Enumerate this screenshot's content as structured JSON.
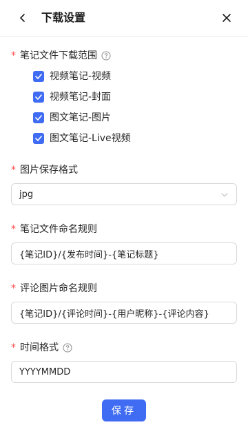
{
  "header": {
    "title": "下载设置",
    "back_icon": "chevron-left-icon",
    "close_icon": "close-icon"
  },
  "note_range": {
    "label": "笔记文件下载范围",
    "required_mark": "*",
    "help_icon": "question-circle-icon",
    "options": [
      {
        "label": "视频笔记-视频",
        "checked": true
      },
      {
        "label": "视频笔记-封面",
        "checked": true
      },
      {
        "label": "图文笔记-图片",
        "checked": true
      },
      {
        "label": "图文笔记-Live视频",
        "checked": true
      }
    ]
  },
  "image_format": {
    "label": "图片保存格式",
    "required_mark": "*",
    "value": "jpg",
    "arrow_icon": "chevron-down-icon"
  },
  "note_naming": {
    "label": "笔记文件命名规则",
    "required_mark": "*",
    "value": "{笔记ID}/{发布时间}-{笔记标题}"
  },
  "comment_naming": {
    "label": "评论图片命名规则",
    "required_mark": "*",
    "value": "{笔记ID}/{评论时间}-{用户昵称}-{评论内容}"
  },
  "time_format": {
    "label": "时间格式",
    "required_mark": "*",
    "help_icon": "question-circle-icon",
    "value": "YYYYMMDD"
  },
  "save_button": {
    "label": "保存"
  },
  "colors": {
    "primary": "#3f6cf3",
    "required": "#ff4d4f",
    "border": "#d9d9d9"
  }
}
